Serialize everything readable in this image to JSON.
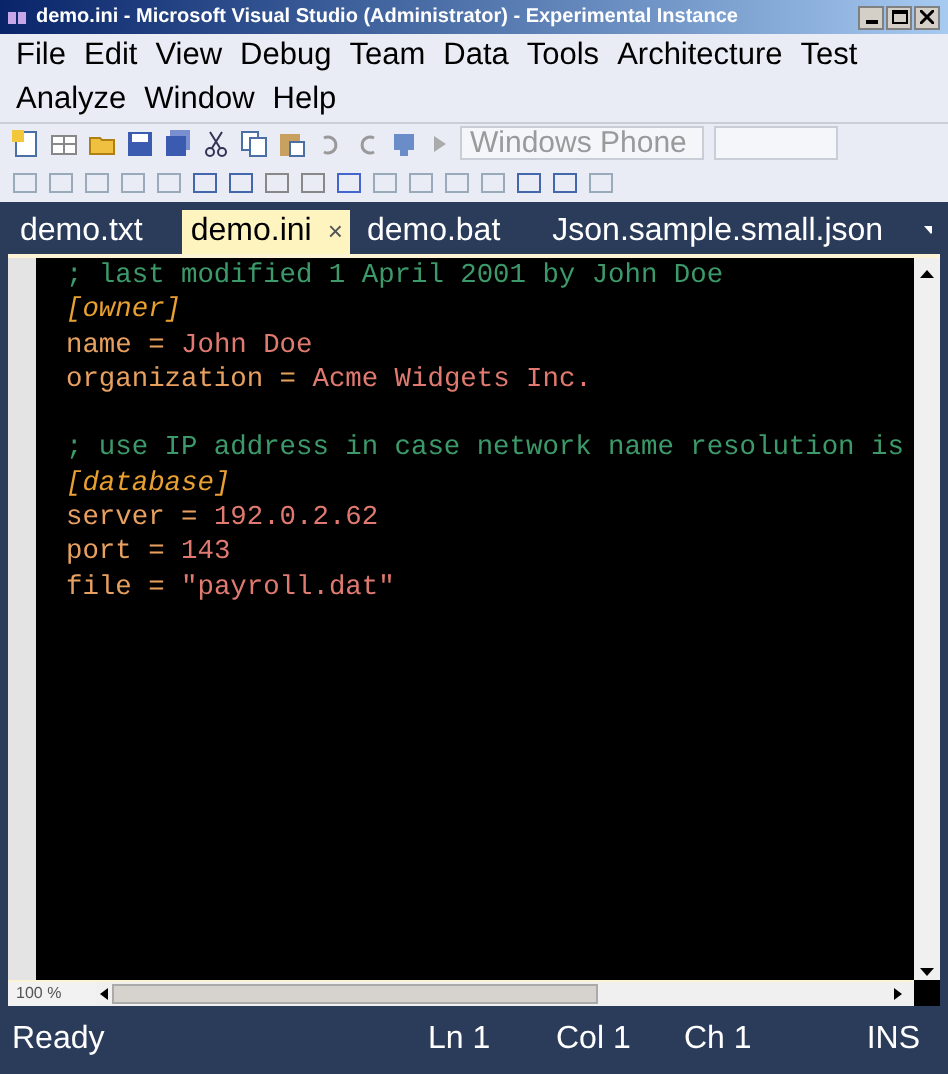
{
  "window": {
    "title": "demo.ini - Microsoft Visual Studio (Administrator) - Experimental Instance"
  },
  "menu": [
    [
      "File",
      "Edit",
      "View",
      "Debug",
      "Team",
      "Data",
      "Tools",
      "Architecture",
      "Test"
    ],
    [
      "Analyze",
      "Window",
      "Help"
    ]
  ],
  "toolbar": {
    "platform_combo": "Windows Phone"
  },
  "tabs": [
    {
      "label": "demo.txt",
      "selected": false
    },
    {
      "label": "demo.ini",
      "selected": true,
      "close": "×"
    },
    {
      "label": "demo.bat",
      "selected": false
    },
    {
      "label": "Json.sample.small.json",
      "selected": false
    }
  ],
  "editor": {
    "lines": [
      {
        "segments": [
          {
            "kind": "comment",
            "text": "; last modified 1 April 2001 by John Doe"
          }
        ]
      },
      {
        "segments": [
          {
            "kind": "section",
            "text": "[owner]"
          }
        ]
      },
      {
        "segments": [
          {
            "kind": "key",
            "text": "name"
          },
          {
            "kind": "op",
            "text": " = "
          },
          {
            "kind": "value",
            "text": "John Doe"
          }
        ]
      },
      {
        "segments": [
          {
            "kind": "key",
            "text": "organization"
          },
          {
            "kind": "op",
            "text": " = "
          },
          {
            "kind": "value",
            "text": "Acme Widgets Inc."
          }
        ]
      },
      {
        "blank_line_before": true,
        "segments": [
          {
            "kind": "comment",
            "text": "; use IP address in case network name resolution is"
          }
        ]
      },
      {
        "segments": [
          {
            "kind": "section",
            "text": "[database]"
          }
        ]
      },
      {
        "segments": [
          {
            "kind": "key",
            "text": "server"
          },
          {
            "kind": "op",
            "text": " = "
          },
          {
            "kind": "value",
            "text": "192.0.2.62"
          }
        ]
      },
      {
        "segments": [
          {
            "kind": "key",
            "text": "port"
          },
          {
            "kind": "op",
            "text": " = "
          },
          {
            "kind": "value",
            "text": "143"
          }
        ]
      },
      {
        "segments": [
          {
            "kind": "key",
            "text": "file"
          },
          {
            "kind": "op",
            "text": " = "
          },
          {
            "kind": "value",
            "text": "\"payroll.dat\""
          }
        ]
      }
    ],
    "zoom": "100 %"
  },
  "status_bar": {
    "message": "Ready",
    "line": "Ln 1",
    "column": "Col 1",
    "char": "Ch 1",
    "mode": "INS"
  }
}
